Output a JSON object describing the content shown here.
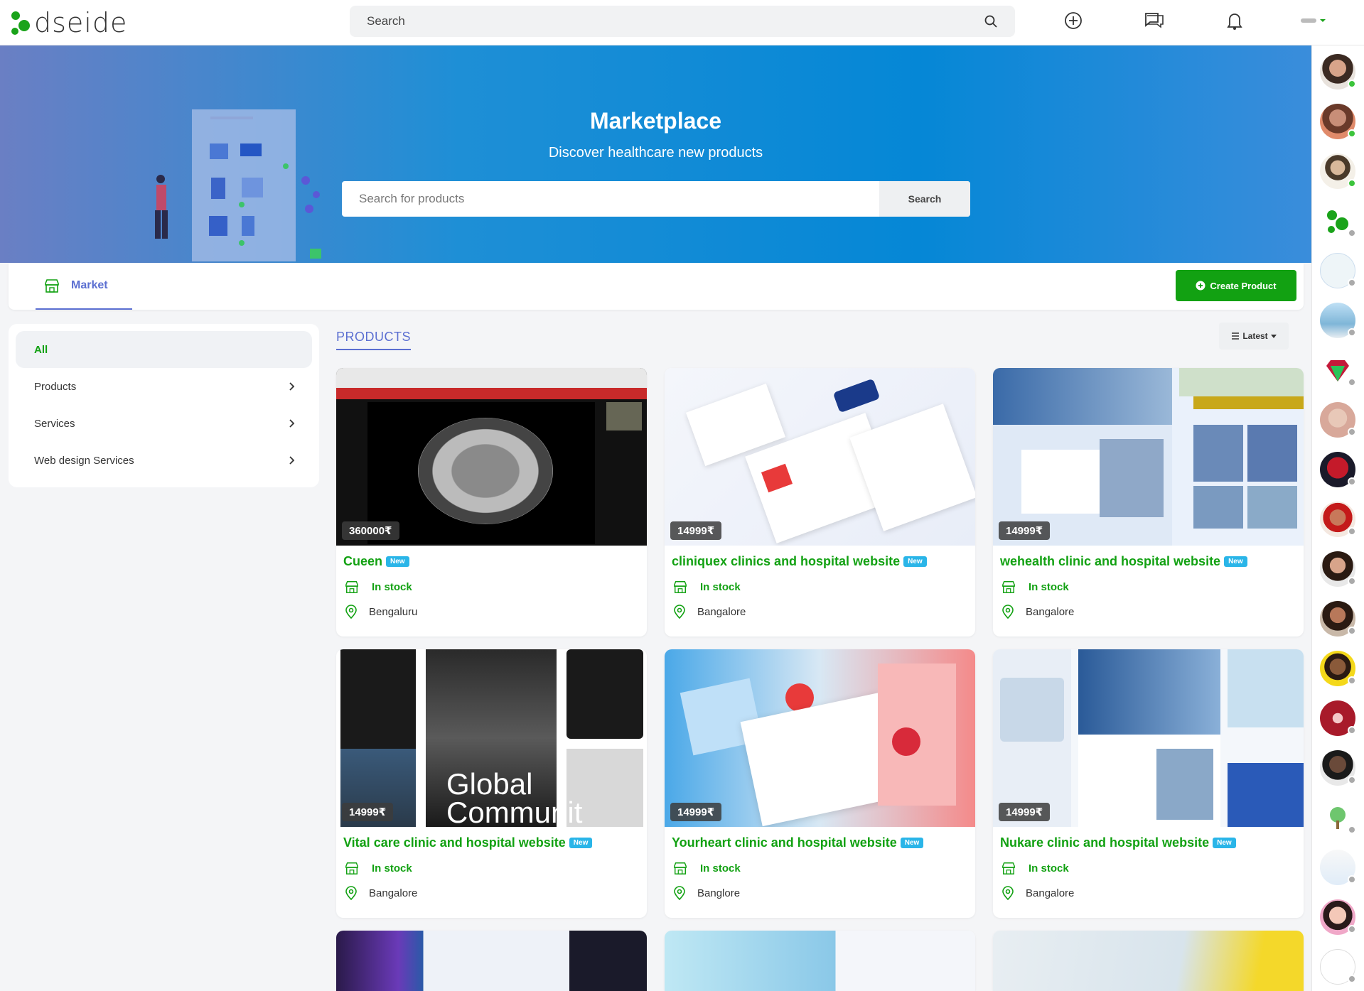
{
  "brand": {
    "name": "dseide"
  },
  "topbar": {
    "search_placeholder": "Search"
  },
  "hero": {
    "title": "Marketplace",
    "subtitle": "Discover healthcare new products",
    "search_placeholder": "Search for products",
    "search_button": "Search"
  },
  "tabs": {
    "market_label": "Market",
    "create_button": "Create Product"
  },
  "sidebar": {
    "items": [
      {
        "label": "All",
        "active": true
      },
      {
        "label": "Products",
        "active": false
      },
      {
        "label": "Services",
        "active": false
      },
      {
        "label": "Web design Services",
        "active": false
      }
    ]
  },
  "products_header": "PRODUCTS",
  "sort": {
    "label": "Latest"
  },
  "cards": [
    {
      "title": "Cueen",
      "badge": "New",
      "price": "360000₹",
      "stock": "In stock",
      "location": "Bengaluru"
    },
    {
      "title": "cliniquex clinics and hospital website",
      "badge": "New",
      "price": "14999₹",
      "stock": "In stock",
      "location": "Bangalore"
    },
    {
      "title": "wehealth clinic and hospital website",
      "badge": "New",
      "price": "14999₹",
      "stock": "In stock",
      "location": "Bangalore"
    },
    {
      "title": "Vital care clinic and hospital website",
      "badge": "New",
      "price": "14999₹",
      "stock": "In stock",
      "location": "Bangalore"
    },
    {
      "title": "Yourheart clinic and hospital website",
      "badge": "New",
      "price": "14999₹",
      "stock": "In stock",
      "location": "Banglore"
    },
    {
      "title": "Nukare clinic and hospital website",
      "badge": "New",
      "price": "14999₹",
      "stock": "In stock",
      "location": "Bangalore"
    }
  ],
  "colors": {
    "accent_green": "#12a112",
    "accent_indigo": "#5b6fd1",
    "badge_blue": "#2ab5e8",
    "hero_blue": "#0587d6"
  }
}
